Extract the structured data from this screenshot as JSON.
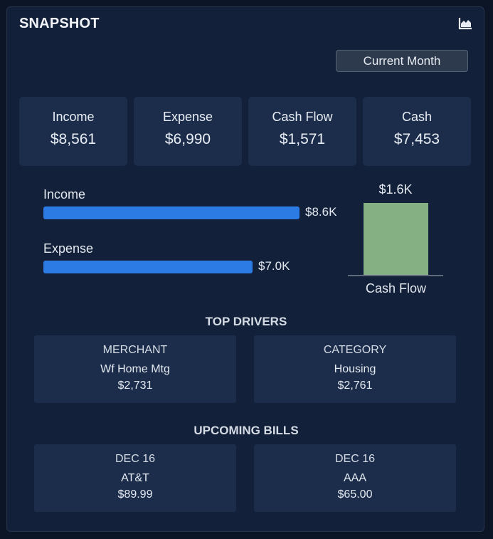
{
  "header": {
    "title": "SNAPSHOT",
    "chart_icon": "area-chart-icon"
  },
  "period": {
    "label": "Current Month"
  },
  "stats": [
    {
      "label": "Income",
      "value": "$8,561"
    },
    {
      "label": "Expense",
      "value": "$6,990"
    },
    {
      "label": "Cash Flow",
      "value": "$1,571"
    },
    {
      "label": "Cash",
      "value": "$7,453"
    }
  ],
  "chart_data": {
    "type": "bar",
    "bars": [
      {
        "label": "Income",
        "value": 8.561,
        "value_label": "$8.6K"
      },
      {
        "label": "Expense",
        "value": 6.99,
        "value_label": "$7.0K"
      }
    ],
    "cash_flow": {
      "label": "Cash Flow",
      "value": 1.571,
      "value_label": "$1.6K"
    },
    "units": "thousands USD",
    "colors": {
      "bar": "#2c7be5",
      "cash_flow": "#84b083"
    }
  },
  "top_drivers": {
    "title": "TOP DRIVERS",
    "merchant": {
      "heading": "MERCHANT",
      "name": "Wf Home Mtg",
      "amount": "$2,731"
    },
    "category": {
      "heading": "CATEGORY",
      "name": "Housing",
      "amount": "$2,761"
    }
  },
  "upcoming_bills": {
    "title": "UPCOMING BILLS",
    "items": [
      {
        "date": "DEC 16",
        "name": "AT&T",
        "amount": "$89.99"
      },
      {
        "date": "DEC 16",
        "name": "AAA",
        "amount": "$65.00"
      }
    ]
  }
}
